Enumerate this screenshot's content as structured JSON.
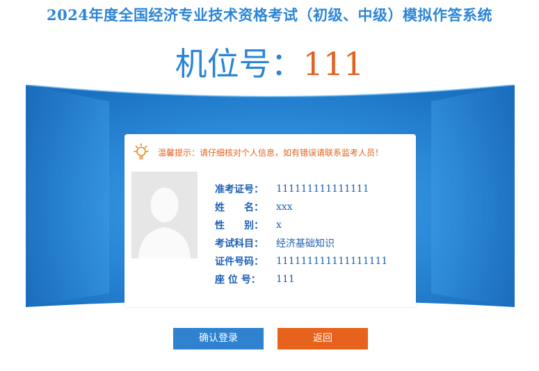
{
  "header": {
    "title": "2024年度全国经济专业技术资格考试（初级、中级）模拟作答系统"
  },
  "machine": {
    "label": "机位号：",
    "number": "111"
  },
  "card": {
    "tip": "温馨提示：请仔细核对个人信息，如有错误请联系监考人员！",
    "fields": [
      {
        "label": "准考证号：",
        "value": "111111111111111"
      },
      {
        "label": "姓　　名：",
        "value": "xxx"
      },
      {
        "label": "性　　别：",
        "value": "x"
      },
      {
        "label": "考试科目：",
        "value": "经济基础知识"
      },
      {
        "label": "证件号码：",
        "value": "111111111111111111"
      },
      {
        "label": "座 位 号：",
        "value": "111"
      }
    ]
  },
  "buttons": {
    "confirm": "确认登录",
    "back": "返回"
  },
  "colors": {
    "primary_blue": "#2b85d6",
    "accent_orange": "#e2621f"
  },
  "icons": {
    "tip": "lightbulb-icon",
    "avatar": "user-silhouette-icon"
  }
}
